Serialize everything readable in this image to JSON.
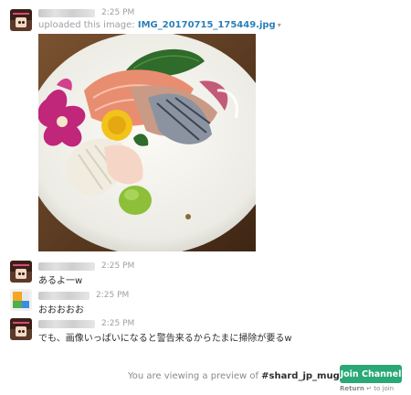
{
  "messages": [
    {
      "time": "2:25 PM",
      "upload_prefix": "uploaded this image:",
      "file_name": "IMG_20170715_175449.jpg",
      "caret": "▾"
    },
    {
      "time": "2:25 PM",
      "text": "あるよ一w"
    },
    {
      "time": "2:25 PM",
      "text": "おおおおお"
    },
    {
      "time": "2:25 PM",
      "text": "でも、画像いっぱいになると警告来るからたまに掃除が要るw"
    }
  ],
  "footer": {
    "preview_text": "You are viewing a preview of",
    "channel_name": "#shard_jp_mugen",
    "join_label": "Join Channel",
    "hint_key": "Return",
    "hint_text": "to join"
  },
  "colors": {
    "link": "#2a80b9",
    "join_button": "#2aa876"
  }
}
